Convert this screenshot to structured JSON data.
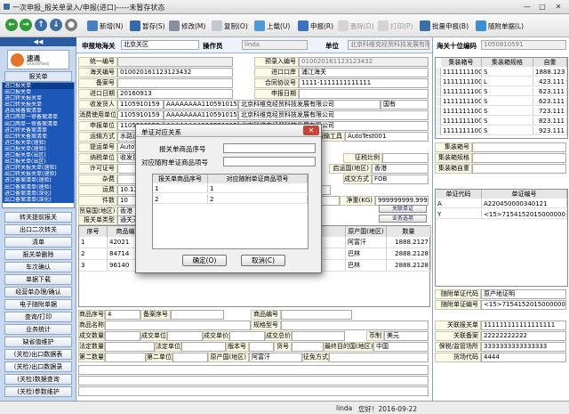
{
  "window": {
    "title": "一次申报_报关单录入/申报(进口)-----未暂存状态",
    "min": "—",
    "max": "□",
    "close": "✕"
  },
  "toolbar": {
    "new": "新增(N)",
    "save": "暂存(S)",
    "edit": "修改(M)",
    "copy": "复制(O)",
    "upload": "上载(U)",
    "declare": "申报(R)",
    "delete": "删除(D)",
    "print": "打印(P)",
    "batch": "批量申报(B)",
    "attach": "随附单据(L)"
  },
  "colors": {
    "accent": "#1d57b8",
    "nav_bg": "#c7d8ef",
    "label_bg": "#fdfbe8",
    "green": "#3aa63a"
  },
  "leftnav": {
    "collapse": "◀◀",
    "logo_name": "速通",
    "logo_sub": "QuickPass",
    "section": "报关单",
    "list": [
      "进口报关单",
      "出口报关单",
      "进口转关报关单",
      "出口转关报关单",
      "进出境备案清单",
      "进口两单一审备案清单",
      "出口两单一审备案清单",
      "进口转关备案清单",
      "出口转关备案清单",
      "进口报关单(速验)",
      "出口报关单(速验)",
      "进口报关单(出区)",
      "出口报关单(出区)",
      "进口转关报关单(速验)",
      "出口转关报关单(速验)",
      "进口备案清单(速验)",
      "出口备案清单(速验)",
      "进口备案清单(深化)",
      "出口备案清单(深化)"
    ],
    "buttons": [
      "转关提前报关",
      "出口二次转关",
      "清单",
      "报关单删除",
      "车次确认",
      "单据下载",
      "经营单办理/确认",
      "电子随附单据",
      "查询/打印",
      "业务统计",
      "缺省值维护",
      "(关检)出口数据表",
      "(关检)出口数据录",
      "(关检)数据查询",
      "(关检)参数维护"
    ]
  },
  "header": {
    "decl_unit_label": "申报地海关",
    "decl_unit_value": "北京关区",
    "operator_label": "操作员",
    "operator_value": "linda",
    "unit_label": "单位",
    "unit_value": "北京科维克经贸科技发展有限公司",
    "seq_label": "海关十位编码",
    "seq_value": "1050810591"
  },
  "form": {
    "unified_no_label": "统一编号",
    "unified_no": "",
    "precheck_label": "预录入编号",
    "precheck": "010020161123123432",
    "customs_no_label": "海关编号",
    "customs_no": "010020161123123432",
    "entry_port_label": "进口口岸",
    "entry_port": "浦江海关",
    "record_no_label": "备案号",
    "record_no": "",
    "contract_label": "合同协议号",
    "contract": "1111-1111111111111",
    "import_date_label": "进口日期",
    "import_date": "20160913",
    "decl_date_label": "申报日期",
    "decl_date": "",
    "consignee_label": "收发货人",
    "consignee_code": "1105910159",
    "consignee_code2": "AAAAAAAA1105910159",
    "consignee_name": "北京科维克经贸科技发展有限公司",
    "country_col": "国有",
    "consumer_label": "消费使用单位",
    "consumer_code": "1105910159",
    "consumer_code2": "AAAAAAAA1105910159",
    "consumer_name": "北京科维克经贸科技发展有限公司",
    "declarer_label": "申报单位",
    "declarer_code": "1105910159",
    "declarer_code2": "AAAAAAAA1105910159",
    "declarer_name": "北京科维克经贸科技发展有限公司",
    "transport_label": "运输方式",
    "transport": "水路运输",
    "vessel_label": "运输工具",
    "vessel": "AutoTest001",
    "bill_label": "提运单号",
    "bill": "AutoTest001",
    "tax_unit_label": "纳税单位",
    "tax_unit": "收发货人",
    "exempt_label": "征税比例",
    "exempt": "",
    "license_label": "许可证号",
    "license": "",
    "trade_country_label": "启运国(地区)",
    "trade_country": "香港",
    "deal_label": "成交方式",
    "deal": "FOB",
    "miscfee_label": "杂费",
    "misc": "",
    "freight_label": "运费",
    "freight": "10.12",
    "ins_label": "保费",
    "insurance": "10.12",
    "pieces_label": "件数",
    "pieces": "10",
    "gross_label": "毛重(KG)",
    "gross": "9999999999.9999",
    "net_label": "净重(KG)",
    "net": "999999999.9999",
    "trade_area_label": "贸易国(地区)",
    "trade_area": "香港",
    "decl_type_label": "报关单类型",
    "decl_type": "通关无纸化",
    "apply_link": "关联单证",
    "rel_link": "业务选项",
    "mark_label": "标记唛码",
    "remark_label": "备注"
  },
  "items_table": {
    "headers": [
      "序号",
      "商品编号",
      "商品名称",
      "规格型号",
      "原产国(地区)",
      "数量"
    ],
    "rows": [
      [
        "1",
        "42021",
        "",
        "",
        "阿富汗",
        "1888.2127"
      ],
      [
        "2",
        "84714",
        "",
        "",
        "巴林",
        "2888.2128"
      ],
      [
        "3",
        "96140",
        "",
        "",
        "巴林",
        "2888.2128"
      ]
    ]
  },
  "detail": {
    "item_no_label": "商品序号",
    "item_no": "4",
    "record_seq_label": "备案序号",
    "code_label": "商品编号",
    "name_label": "商品名称",
    "spec_label": "规格型号",
    "qty_label": "成交数量",
    "unit_label": "成交单位",
    "unit_price_label": "成交单价",
    "total_label": "成交总价",
    "currency_label": "币制",
    "currency": "美元",
    "legal_qty_label": "法定数量",
    "legal_unit_label": "法定单位",
    "version_label": "版本号",
    "goods_no_label": "货号",
    "dest_label": "最终目的国(地区)",
    "dest": "中国",
    "second_qty_label": "第二数量",
    "second_unit_label": "第二单位",
    "origin_label": "原产国(地区)",
    "origin": "阿富汗",
    "levy_label": "征免方式"
  },
  "right_panel": {
    "box_table_headers": [
      "集装箱号",
      "集装箱规格",
      "自重"
    ],
    "box_rows": [
      [
        "11111111003",
        "S",
        "1888.123"
      ],
      [
        "11111111004",
        "L",
        "423.111"
      ],
      [
        "11111111005",
        "S",
        "623.111"
      ],
      [
        "11111111006",
        "S",
        "623.111"
      ],
      [
        "11111111007",
        "S",
        "723.111"
      ],
      [
        "11111111008",
        "S",
        "823.111"
      ],
      [
        "11111111009",
        "S",
        "923.111"
      ]
    ],
    "box_no_label": "集装箱号",
    "box_spec_label": "集装箱规格",
    "box_weight_label": "集装箱自重",
    "doc_headers": [
      "单证代码",
      "单证编号"
    ],
    "doc_rows": [
      [
        "A",
        "A220450000340121"
      ],
      [
        "Y",
        "<15>7154152015000000"
      ]
    ],
    "attach_code_label": "随附单证代码",
    "attach_code": "原产地证明",
    "attach_no_label": "随附单证编号",
    "attach_no": "<15>7154152015000000085",
    "rel_decl_label": "关联报关单",
    "rel_decl": "111111111111111111",
    "rel_record_label": "关联备案",
    "rel_record": "22222222222",
    "bonded_label": "保税/监管场所",
    "bonded": "3333333333333333",
    "yard_label": "货场代码",
    "yard": "4444"
  },
  "dialog": {
    "title": "单证对应关系",
    "close": "✕",
    "field1_label": "报关单商品序号",
    "field2_label": "对应随附单证商品项号",
    "table_headers": [
      "报关单商品序号",
      "对应随附单证商品项号"
    ],
    "rows": [
      [
        "1",
        "1"
      ],
      [
        "2",
        "2"
      ]
    ],
    "ok": "确定(O)",
    "cancel": "取消(C)"
  },
  "status": {
    "user": "linda",
    "greeting": "您好！2016-09-22"
  }
}
